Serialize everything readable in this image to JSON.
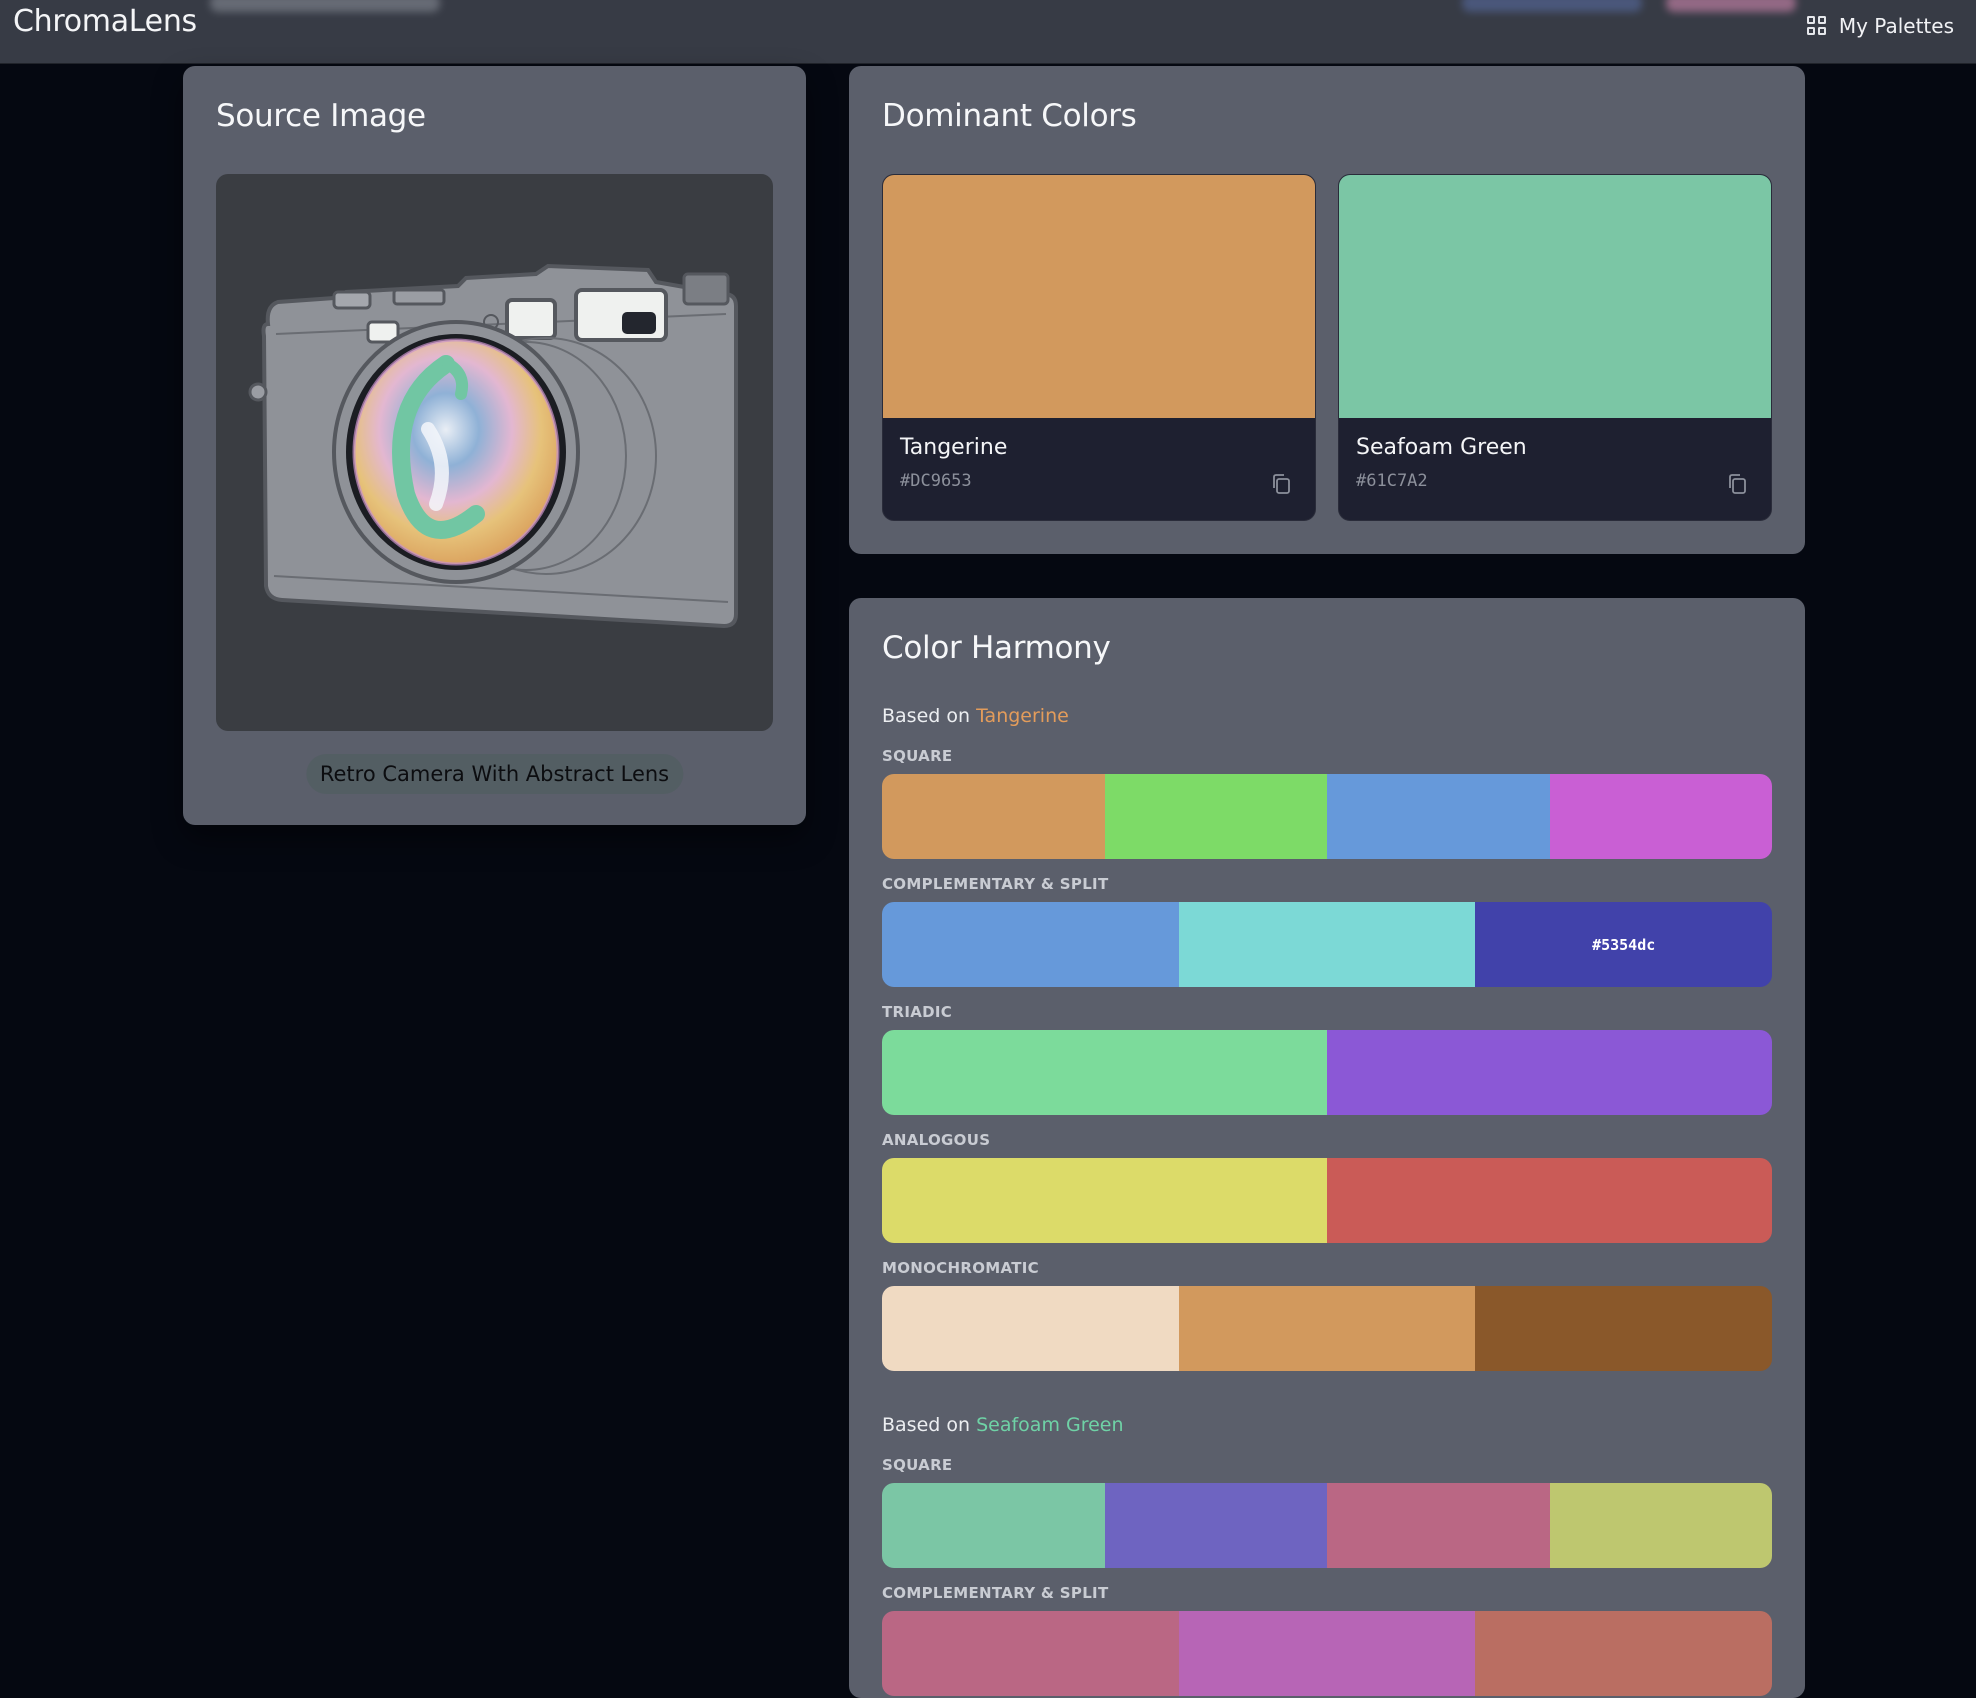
{
  "app": {
    "brand": "ChromaLens",
    "nav": {
      "palettes_label": "My Palettes"
    }
  },
  "source": {
    "title": "Source Image",
    "caption": "Retro Camera With Abstract Lens"
  },
  "dominant": {
    "title": "Dominant Colors",
    "colors": [
      {
        "name": "Tangerine",
        "hex": "#DC9653",
        "swatch": "#d2995d"
      },
      {
        "name": "Seafoam Green",
        "hex": "#61C7A2",
        "swatch": "#7bc6a5"
      }
    ]
  },
  "harmony": {
    "title": "Color Harmony",
    "based_on_prefix": "Based on",
    "groups": [
      {
        "base_name": "Tangerine",
        "base_color": "#e39c5b",
        "schemes": [
          {
            "label": "SQUARE",
            "colors": [
              "#d2995d",
              "#7ddb67",
              "#6699da",
              "#c95fd4"
            ],
            "hover": null
          },
          {
            "label": "COMPLEMENTARY & SPLIT",
            "colors": [
              "#6699da",
              "#7cd9d6",
              "#4142aa"
            ],
            "hover": "#5354dc"
          },
          {
            "label": "TRIADIC",
            "colors": [
              "#7cdb9b",
              "#8b58d6"
            ],
            "hover": null
          },
          {
            "label": "ANALOGOUS",
            "colors": [
              "#dcdb69",
              "#ca5b57"
            ],
            "hover": null
          },
          {
            "label": "MONOCHROMATIC",
            "colors": [
              "#f0dac2",
              "#d2995d",
              "#8a582a"
            ],
            "hover": null
          }
        ]
      },
      {
        "base_name": "Seafoam Green",
        "base_color": "#6fd2a6",
        "schemes": [
          {
            "label": "SQUARE",
            "colors": [
              "#7bc6a5",
              "#6e64c1",
              "#ba6784",
              "#bec76f"
            ],
            "hover": null
          },
          {
            "label": "COMPLEMENTARY & SPLIT",
            "colors": [
              "#ba6784",
              "#b765b6",
              "#ba6e62"
            ],
            "hover": null
          }
        ]
      }
    ]
  },
  "icons": {
    "nav": "grid-icon",
    "copy": "copy-icon"
  }
}
